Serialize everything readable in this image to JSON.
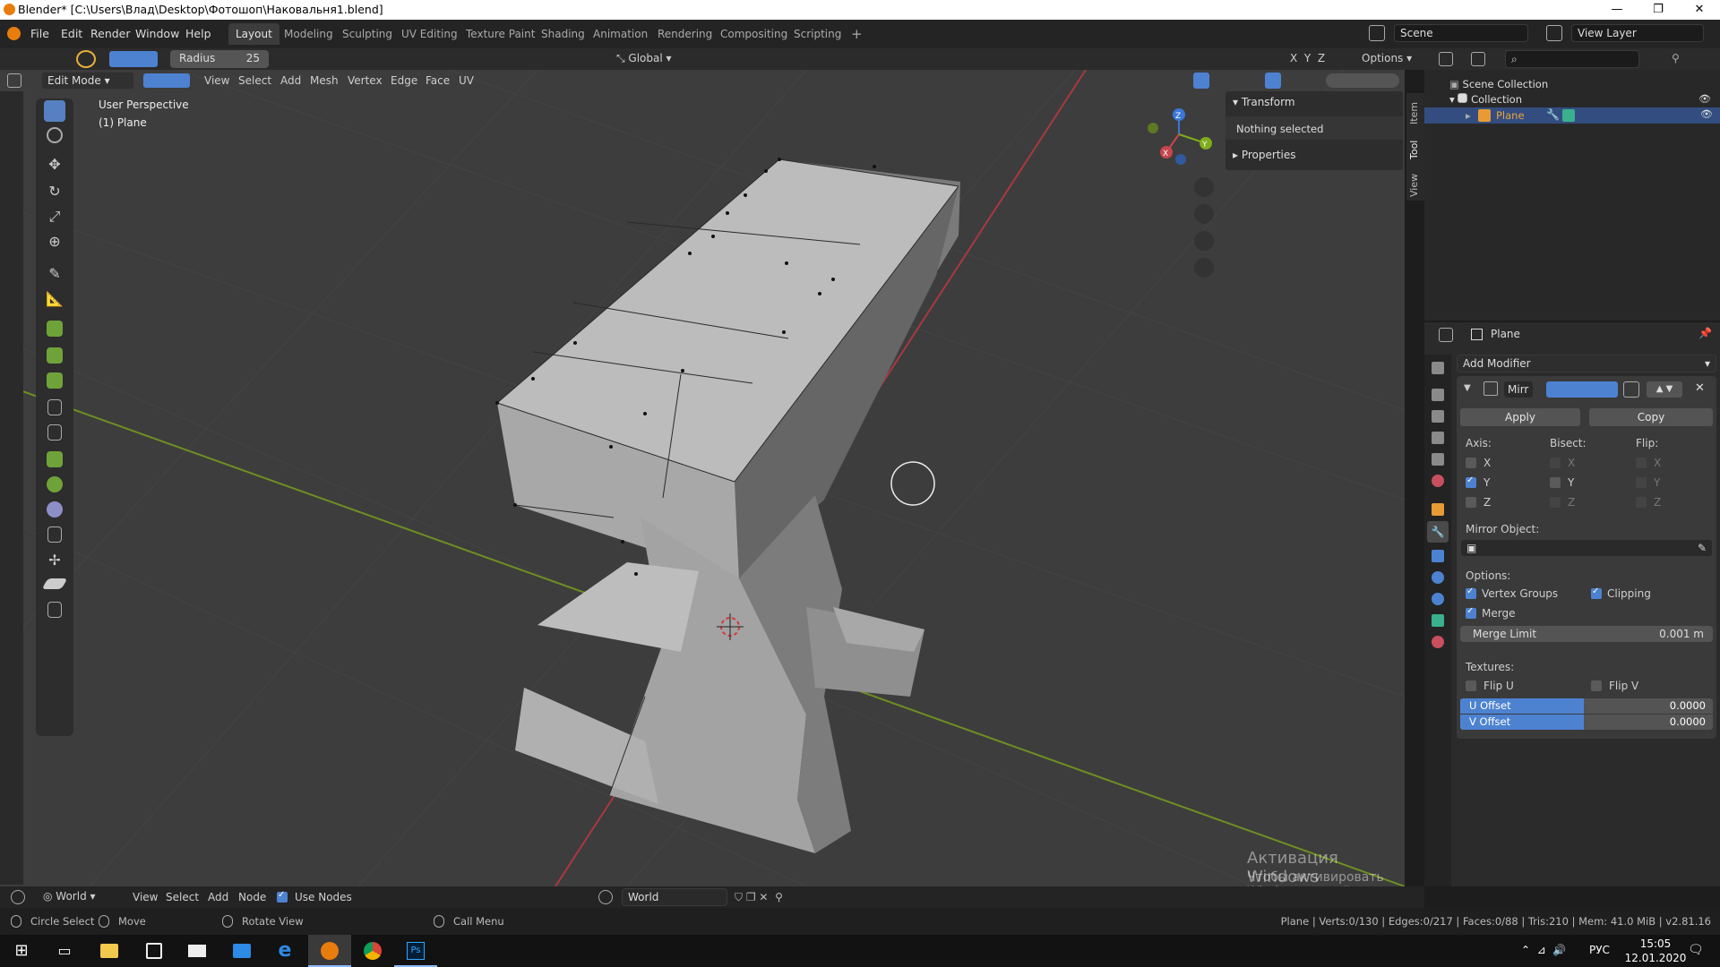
{
  "titlebar": {
    "title": "Blender* [C:\\Users\\Влад\\Desktop\\Фотошоп\\Наковальня1.blend]",
    "minimize": "—",
    "maximize": "❐",
    "close": "✕"
  },
  "menu": [
    "File",
    "Edit",
    "Render",
    "Window",
    "Help"
  ],
  "workspaces": [
    "Layout",
    "Modeling",
    "Sculpting",
    "UV Editing",
    "Texture Paint",
    "Shading",
    "Animation",
    "Rendering",
    "Compositing",
    "Scripting"
  ],
  "add_workspace": "+",
  "scene": {
    "scene_name": "Scene",
    "view_layer": "View Layer"
  },
  "toolheader": {
    "radius_label": "Radius",
    "radius_value": "25",
    "transform_orientation": "Global",
    "axes": [
      "X",
      "Y",
      "Z"
    ],
    "options": "Options"
  },
  "header3d": {
    "mode": "Edit Mode",
    "menus": [
      "View",
      "Select",
      "Add",
      "Mesh",
      "Vertex",
      "Edge",
      "Face",
      "UV"
    ]
  },
  "viewport": {
    "perspective": "User Perspective",
    "object": "(1) Plane",
    "gizmo_axes": [
      "Z",
      "Y",
      "X"
    ]
  },
  "npanel": {
    "transform": "Transform",
    "nothing_selected": "Nothing selected",
    "properties": "Properties",
    "tabs": [
      "Item",
      "Tool",
      "View"
    ]
  },
  "outliner": {
    "scene_collection": "Scene Collection",
    "collection": "Collection",
    "plane": "Plane"
  },
  "properties": {
    "object_name": "Plane",
    "add_modifier": "Add Modifier",
    "modifier_name": "Mirr",
    "apply": "Apply",
    "copy": "Copy",
    "axis": "Axis:",
    "bisect": "Bisect:",
    "flip": "Flip:",
    "axis_x": "X",
    "axis_y": "Y",
    "axis_z": "Z",
    "mirror_object": "Mirror Object:",
    "options": "Options:",
    "vertex_groups": "Vertex Groups",
    "clipping": "Clipping",
    "merge": "Merge",
    "merge_limit_label": "Merge Limit",
    "merge_limit_value": "0.001 m",
    "textures": "Textures:",
    "flip_u": "Flip U",
    "flip_v": "Flip V",
    "u_offset_label": "U Offset",
    "u_offset_value": "0.0000",
    "v_offset_label": "V Offset",
    "v_offset_value": "0.0000"
  },
  "timeline": {
    "world_type": "World",
    "menus": [
      "View",
      "Select",
      "Add",
      "Node"
    ],
    "use_nodes": "Use Nodes",
    "world_name": "World"
  },
  "statusbar": {
    "circle_select": "Circle Select",
    "move": "Move",
    "rotate_view": "Rotate View",
    "call_menu": "Call Menu",
    "stats": "Plane | Verts:0/130 | Edges:0/217 | Faces:0/88 | Tris:210 | Mem: 41.0 MiB | v2.81.16"
  },
  "watermark": {
    "title": "Активация Windows",
    "subtitle": "Чтобы активировать Windows, перейдите в раздел \"Параметры\"."
  },
  "taskbar": {
    "lang": "РУС",
    "time": "15:05",
    "date": "12.01.2020"
  },
  "colors": {
    "accent": "#4d82d1",
    "active_tool": "#5680c2",
    "x_axis": "#c8464f",
    "y_axis": "#7fac1c",
    "z_axis": "#3a77d8",
    "mesh": "#b4b4b4"
  }
}
